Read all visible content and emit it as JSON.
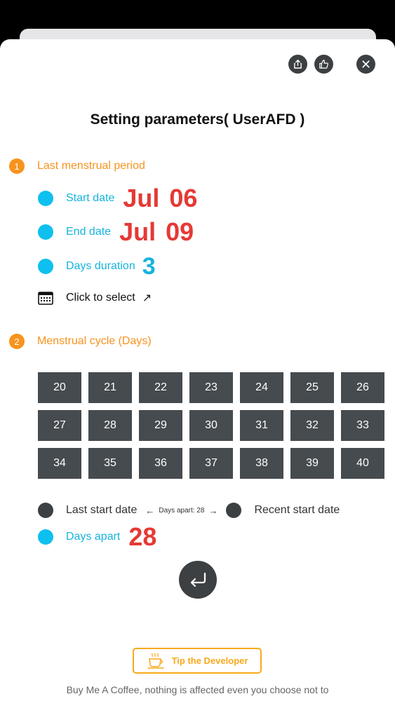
{
  "header": {
    "share_icon": "share-icon",
    "like_icon": "thumbs-up-icon",
    "close_icon": "close-icon"
  },
  "title": "Setting parameters( UserAFD )",
  "section1": {
    "number": "1",
    "label": "Last menstrual period",
    "start_label": "Start date",
    "start_month": "Jul",
    "start_day": "06",
    "end_label": "End date",
    "end_month": "Jul",
    "end_day": "09",
    "duration_label": "Days duration",
    "duration_value": "3",
    "select_label": "Click to select",
    "select_arrow": "↗"
  },
  "section2": {
    "number": "2",
    "label": "Menstrual cycle (Days)",
    "cycle_days": [
      "20",
      "21",
      "22",
      "23",
      "24",
      "25",
      "26",
      "27",
      "28",
      "29",
      "30",
      "31",
      "32",
      "33",
      "34",
      "35",
      "36",
      "37",
      "38",
      "39",
      "40"
    ]
  },
  "legend": {
    "last_start": "Last start date",
    "left_arrow": "←",
    "days_apart_small": "Days apart: 28",
    "right_arrow": "→",
    "recent_start": "Recent start date",
    "days_apart_label": "Days apart",
    "days_apart_value": "28"
  },
  "tip": {
    "label": "Tip the Developer",
    "icon": "coffee-cup-icon"
  },
  "footer": "Buy Me A Coffee, nothing is affected even you choose not to",
  "colors": {
    "accent_orange": "#f7931e",
    "accent_blue": "#16b4dd",
    "value_red": "#e53935",
    "dark": "#3c4043"
  }
}
